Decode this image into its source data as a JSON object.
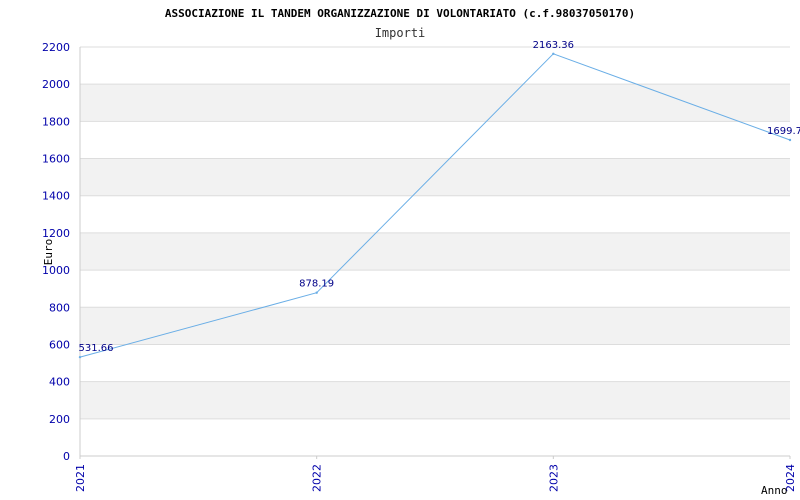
{
  "chart_data": {
    "type": "line",
    "title": "ASSOCIAZIONE IL TANDEM ORGANIZZAZIONE DI VOLONTARIATO (c.f.98037050170)",
    "subtitle": "Importi",
    "xlabel": "Anno",
    "ylabel": "Euro",
    "categories": [
      "2021",
      "2022",
      "2023",
      "2024"
    ],
    "series": [
      {
        "values": [
          531.66,
          878.19,
          2163.36,
          1699.7
        ],
        "labels": [
          "531.66",
          "878.19",
          "2163.36",
          "1699.7"
        ]
      }
    ],
    "ylim": [
      0,
      2200
    ],
    "yticks": [
      0,
      200,
      400,
      600,
      800,
      1000,
      1200,
      1400,
      1600,
      1800,
      2000,
      2200
    ],
    "grid": true,
    "alternating_bands": true,
    "colors": {
      "line": "#6aaee6",
      "band": "#f2f2f2",
      "grid": "#dddddd",
      "tick_text": "#0000aa",
      "data_label_text": "#000088"
    }
  }
}
